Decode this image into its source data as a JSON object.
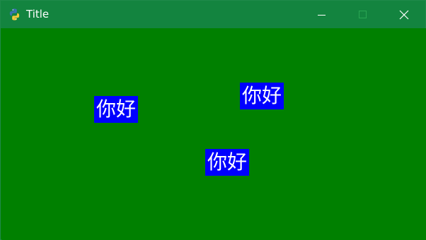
{
  "window": {
    "title": "Title",
    "icon": "python-icon",
    "controls": {
      "minimize_icon": "minimize-icon",
      "maximize_icon": "maximize-icon",
      "close_icon": "close-icon"
    },
    "colors": {
      "titlebar": "#13843f",
      "background": "#008000",
      "label_background": "#0000ff",
      "label_text": "#ffffff"
    }
  },
  "labels": [
    {
      "text": "你好"
    },
    {
      "text": "你好"
    },
    {
      "text": "你好"
    }
  ]
}
